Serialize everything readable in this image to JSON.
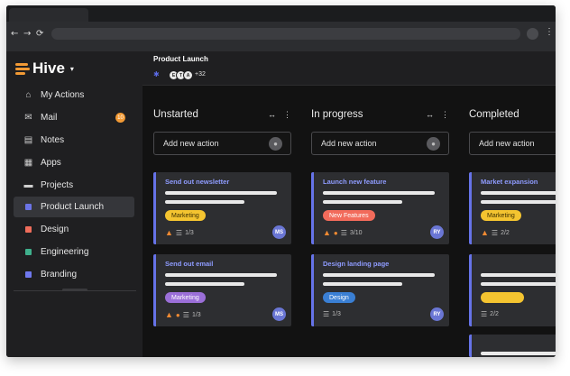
{
  "browser": {
    "back_icon": "←",
    "forward_icon": "→",
    "reload_icon": "⟳",
    "menu_icon": "⋮"
  },
  "app": {
    "name": "Hive",
    "caret": "▾"
  },
  "sidebar": {
    "items": [
      {
        "label": "My Actions",
        "icon": "⌂"
      },
      {
        "label": "Mail",
        "icon": "✉",
        "badge": "10"
      },
      {
        "label": "Notes",
        "icon": "▤"
      },
      {
        "label": "Apps",
        "icon": "▦"
      },
      {
        "label": "Projects",
        "icon": "▬"
      },
      {
        "label": "Product Launch",
        "color": "#6b74e6",
        "active": true
      },
      {
        "label": "Design",
        "color": "#ef6d5b"
      },
      {
        "label": "Engineering",
        "color": "#3fb08c"
      },
      {
        "label": "Branding",
        "color": "#6f78ee"
      }
    ]
  },
  "project": {
    "title": "Product Launch",
    "pin_icon": "✱",
    "members": [
      {
        "initials": "E"
      },
      {
        "initials": "T"
      },
      {
        "initials": "A"
      }
    ],
    "more": "+32"
  },
  "columns": [
    {
      "title": "Unstarted",
      "tools": [
        "↔",
        "⋮"
      ],
      "add_label": "Add new action",
      "cards": [
        {
          "title": "Send out newsletter",
          "tag": "Marketing",
          "tag_color": "#f4c430",
          "tag_text_color": "#3b2e00",
          "warn": "▲",
          "comment": "",
          "checklist": "1/3",
          "user": "MS"
        },
        {
          "title": "Send out email",
          "tag": "Marketing",
          "tag_color": "#9b6fd8",
          "tag_text_color": "#ffffff",
          "warn": "▲",
          "comment": "●",
          "checklist": "1/3",
          "user": "MS"
        }
      ]
    },
    {
      "title": "In progress",
      "tools": [
        "↔",
        "⋮"
      ],
      "add_label": "Add new action",
      "cards": [
        {
          "title": "Launch new feature",
          "tag": "New Features",
          "tag_color": "#f26b5b",
          "tag_text_color": "#ffffff",
          "warn": "▲",
          "comment": "●",
          "checklist": "3/10",
          "user": "RY"
        },
        {
          "title": "Design landing page",
          "tag": "Design",
          "tag_color": "#3a7fd4",
          "tag_text_color": "#ffffff",
          "warn": "",
          "comment": "",
          "checklist": "1/3",
          "user": "RY"
        }
      ]
    },
    {
      "title": "Completed",
      "tools": [],
      "add_label": "Add new action",
      "cards": [
        {
          "title": "Market expansion",
          "tag": "Marketing",
          "tag_color": "#f4c430",
          "tag_text_color": "#3b2e00",
          "warn": "▲",
          "comment": "",
          "checklist": "2/2",
          "user": ""
        },
        {
          "title": "",
          "tag": "",
          "tag_color": "#f4c430",
          "tag_text_color": "#3b2e00",
          "warn": "",
          "comment": "",
          "checklist": "2/2",
          "user": ""
        }
      ]
    }
  ]
}
